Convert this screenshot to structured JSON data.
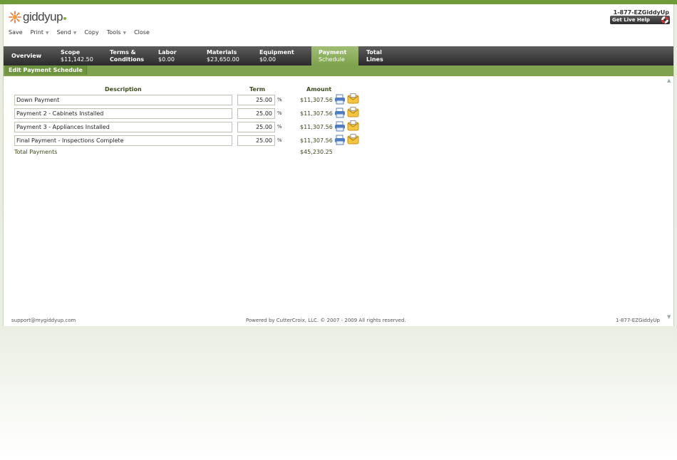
{
  "header": {
    "logo_text": "giddyup",
    "phone": "1-877-EZGiddyUp",
    "live_help": "Get Live Help"
  },
  "menu": [
    {
      "label": "Save",
      "dropdown": false
    },
    {
      "label": "Print",
      "dropdown": true
    },
    {
      "label": "Send",
      "dropdown": true
    },
    {
      "label": "Copy",
      "dropdown": false
    },
    {
      "label": "Tools",
      "dropdown": true
    },
    {
      "label": "Close",
      "dropdown": false
    }
  ],
  "tabs": [
    {
      "line1": "Overview",
      "line2": ""
    },
    {
      "line1": "Scope",
      "line2": "$11,142.50"
    },
    {
      "line1": "Terms &",
      "line2": "Conditions"
    },
    {
      "line1": "Labor",
      "line2": "$0.00"
    },
    {
      "line1": "Materials",
      "line2": "$23,650.00"
    },
    {
      "line1": "Equipment",
      "line2": "$0.00"
    },
    {
      "line1": "Payment",
      "line2": "Schedule",
      "active": true
    },
    {
      "line1": "Total",
      "line2": "Lines"
    }
  ],
  "section": {
    "title": "Edit Payment Schedule"
  },
  "table": {
    "headers": {
      "description": "Description",
      "term": "Term",
      "amount": "Amount"
    },
    "rows": [
      {
        "description": "Down Payment",
        "term": "25.00",
        "unit": "%",
        "amount": "$11,307.56"
      },
      {
        "description": "Payment 2 - Cabinets Installed",
        "term": "25.00",
        "unit": "%",
        "amount": "$11,307.56"
      },
      {
        "description": "Payment 3 - Appliances Installed",
        "term": "25.00",
        "unit": "%",
        "amount": "$11,307.56"
      },
      {
        "description": "Final Payment - Inspections Complete",
        "term": "25.00",
        "unit": "%",
        "amount": "$11,307.56"
      }
    ],
    "total_label": "Total Payments",
    "total_value": "$45,230.25"
  },
  "footer": {
    "email": "support@mygiddyup.com",
    "copyright": "Powered by CutterCroix, LLC. © 2007 - 2009 All rights reserved.",
    "phone": "1-877-EZGiddyUp"
  },
  "colors": {
    "accent_green": "#7ea24d",
    "tab_dark": "#2b2b2b",
    "text_green": "#3b4a1c"
  }
}
